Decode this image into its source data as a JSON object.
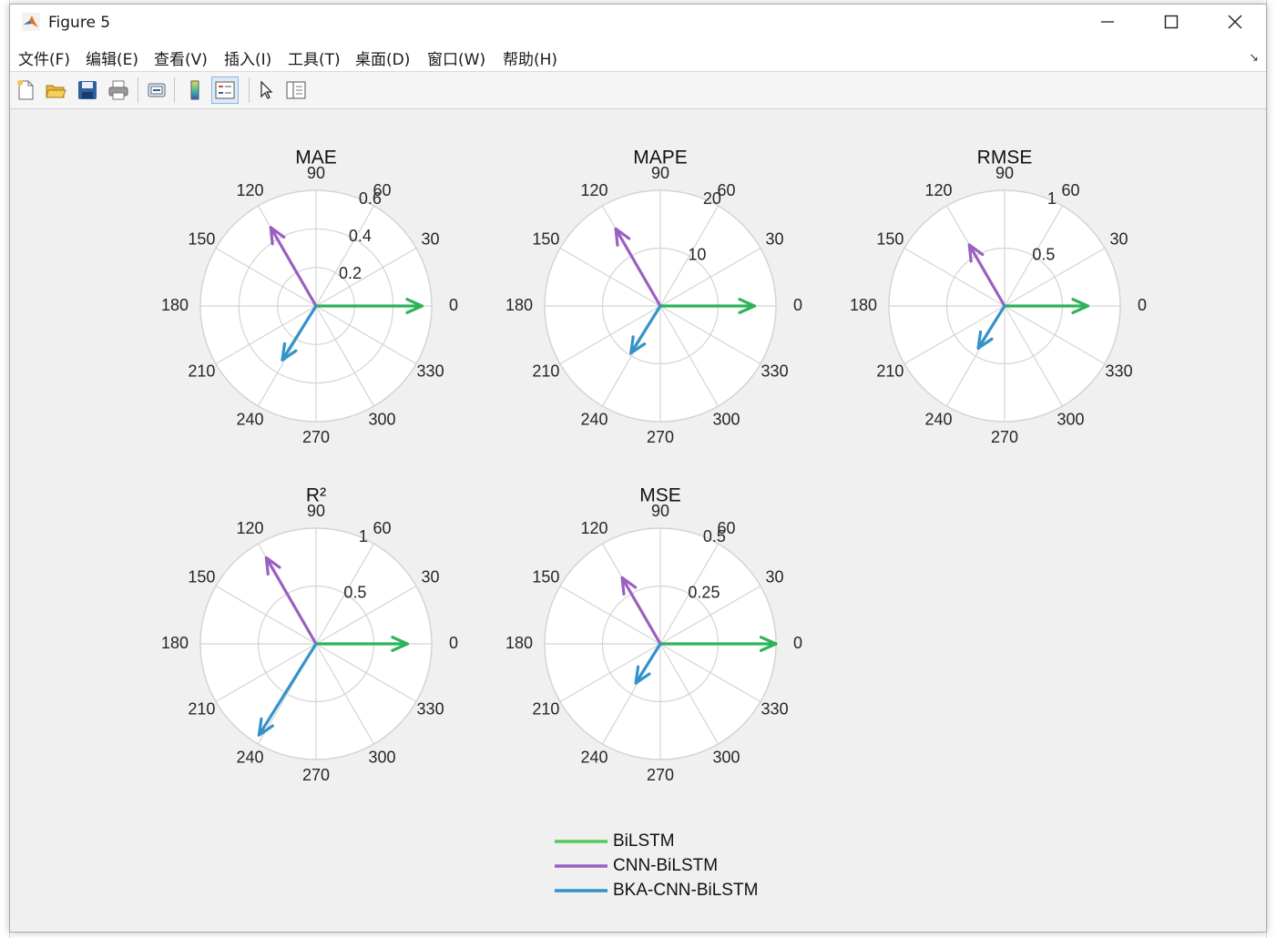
{
  "window": {
    "title": "Figure 5",
    "controls": {
      "minimize": "minimize-icon",
      "maximize": "maximize-icon",
      "close": "close-icon"
    }
  },
  "menu": {
    "items": [
      "文件(F)",
      "编辑(E)",
      "查看(V)",
      "插入(I)",
      "工具(T)",
      "桌面(D)",
      "窗口(W)",
      "帮助(H)"
    ],
    "overflow_icon": "↘"
  },
  "toolbar": {
    "buttons": [
      "new-figure-icon",
      "open-file-icon",
      "save-icon",
      "print-icon",
      "link-icon",
      "colorbar-icon",
      "legend-icon",
      "pointer-icon",
      "property-editor-icon"
    ],
    "active": "legend-icon"
  },
  "colors": {
    "BiLSTM": "#2db35a",
    "CNN-BiLSTM": "#9b5fc0",
    "BKA-CNN-BiLSTM": "#3393c8",
    "grid": "#d4d4d4",
    "axes_bg": "#ffffff"
  },
  "chart_data": [
    {
      "type": "compass",
      "title": "MAE",
      "angles_deg": [
        0,
        30,
        60,
        90,
        120,
        150,
        180,
        210,
        240,
        270,
        300,
        330
      ],
      "r_ticks": [
        0.2,
        0.4,
        0.6
      ],
      "r_max": 0.6,
      "series": [
        {
          "name": "BiLSTM",
          "angle_deg": 0,
          "r": 0.55
        },
        {
          "name": "CNN-BiLSTM",
          "angle_deg": 120,
          "r": 0.47
        },
        {
          "name": "BKA-CNN-BiLSTM",
          "angle_deg": 238,
          "r": 0.33
        }
      ]
    },
    {
      "type": "compass",
      "title": "MAPE",
      "angles_deg": [
        0,
        30,
        60,
        90,
        120,
        150,
        180,
        210,
        240,
        270,
        300,
        330
      ],
      "r_ticks": [
        10,
        20
      ],
      "r_max": 20,
      "series": [
        {
          "name": "BiLSTM",
          "angle_deg": 0,
          "r": 16.3
        },
        {
          "name": "CNN-BiLSTM",
          "angle_deg": 120,
          "r": 15.4
        },
        {
          "name": "BKA-CNN-BiLSTM",
          "angle_deg": 238,
          "r": 9.6
        }
      ]
    },
    {
      "type": "compass",
      "title": "RMSE",
      "angles_deg": [
        0,
        30,
        60,
        90,
        120,
        150,
        180,
        210,
        240,
        270,
        300,
        330
      ],
      "r_ticks": [
        0.5,
        1
      ],
      "r_max": 1,
      "series": [
        {
          "name": "BiLSTM",
          "angle_deg": 0,
          "r": 0.72
        },
        {
          "name": "CNN-BiLSTM",
          "angle_deg": 120,
          "r": 0.61
        },
        {
          "name": "BKA-CNN-BiLSTM",
          "angle_deg": 238,
          "r": 0.43
        }
      ]
    },
    {
      "type": "compass",
      "title": "R²",
      "angles_deg": [
        0,
        30,
        60,
        90,
        120,
        150,
        180,
        210,
        240,
        270,
        300,
        330
      ],
      "r_ticks": [
        0.5,
        1
      ],
      "r_max": 1,
      "series": [
        {
          "name": "BiLSTM",
          "angle_deg": 0,
          "r": 0.79
        },
        {
          "name": "CNN-BiLSTM",
          "angle_deg": 120,
          "r": 0.86
        },
        {
          "name": "BKA-CNN-BiLSTM",
          "angle_deg": 238,
          "r": 0.93
        }
      ]
    },
    {
      "type": "compass",
      "title": "MSE",
      "angles_deg": [
        0,
        30,
        60,
        90,
        120,
        150,
        180,
        210,
        240,
        270,
        300,
        330
      ],
      "r_ticks": [
        0.25,
        0.5
      ],
      "r_max": 0.5,
      "series": [
        {
          "name": "BiLSTM",
          "angle_deg": 0,
          "r": 0.5
        },
        {
          "name": "CNN-BiLSTM",
          "angle_deg": 120,
          "r": 0.33
        },
        {
          "name": "BKA-CNN-BiLSTM",
          "angle_deg": 238,
          "r": 0.2
        }
      ]
    }
  ],
  "legend": {
    "placement": "bottom-center",
    "entries": [
      "BiLSTM",
      "CNN-BiLSTM",
      "BKA-CNN-BiLSTM"
    ]
  }
}
